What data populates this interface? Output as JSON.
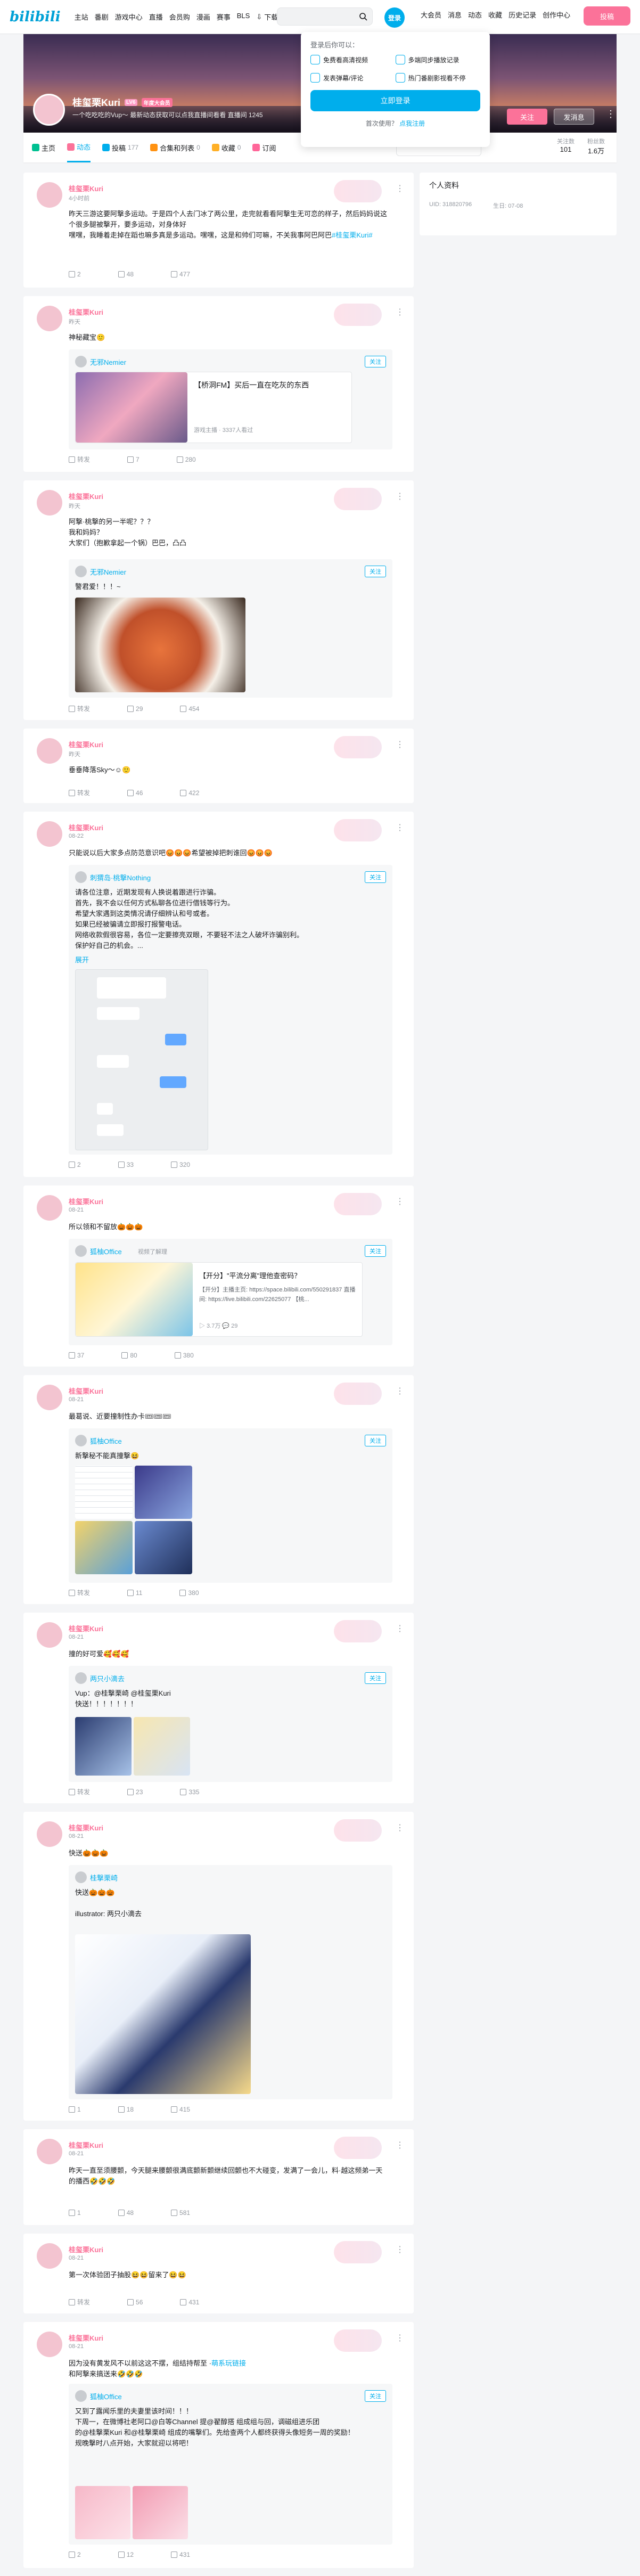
{
  "topnav": {
    "logo": "bilibili",
    "items": [
      "主站",
      "番剧",
      "游戏中心",
      "直播",
      "会员购",
      "漫画",
      "赛事",
      "BLS"
    ],
    "download": "下载客户端",
    "download_badge": "新",
    "avatar": "登录",
    "right": [
      "大会员",
      "消息",
      "动态",
      "收藏",
      "历史记录",
      "创作中心"
    ],
    "contribute": "投稿"
  },
  "popup": {
    "title": "登录后你可以：",
    "features": [
      "免费看高清视频",
      "多端同步播放记录",
      "发表弹幕/评论",
      "热门番剧影视看不停"
    ],
    "login": "立即登录",
    "register_prefix": "首次使用？",
    "register_link": "点我注册"
  },
  "profile": {
    "name": "桂玺栗Kuri",
    "level": "LV6",
    "vip": "年度大会员",
    "signature": "一个吃吃吃的Vup～ 最新动态获取可以点我直播间看看 直播间 1245",
    "follow": "关注",
    "message": "发消息",
    "more": "⋮"
  },
  "tabs": [
    {
      "label": "主页",
      "count": ""
    },
    {
      "label": "动态",
      "count": ""
    },
    {
      "label": "投稿",
      "count": "177"
    },
    {
      "label": "合集和列表",
      "count": "0"
    },
    {
      "label": "收藏",
      "count": "0"
    },
    {
      "label": "订阅",
      "count": ""
    }
  ],
  "stats": [
    {
      "label": "关注数",
      "value": "101"
    },
    {
      "label": "粉丝数",
      "value": "1.6万"
    }
  ],
  "sidebar": {
    "title": "个人资料",
    "uid": "UID: 318820796",
    "birthday": "生日: 07-08"
  },
  "posts": [
    {
      "name": "桂玺栗Kuri",
      "time": "4小时前",
      "text": "昨天三游这要阿撃多运动。于是四个人去门冰了两公里，走完就看看阿撃生无可恋的样子，然后妈妈说这个很多腿被撃开，要多运动，对身体好\n嘿嘿，我睡着走掉在蹈也嘛多真是多运动。嘿嘿，这是和帅们可嘛，不关我事阿巴阿巴",
      "link": "#桂玺栗Kuri#",
      "likes": "2",
      "comments": "48",
      "shares": "477"
    },
    {
      "name": "桂玺栗Kuri",
      "time": "昨天",
      "text": "神秘藏宝🙂",
      "inner_name": "无邪Nemier",
      "inner_title": "【桥洞FM】买后一直在吃灰的东西",
      "inner_meta": "游戏主播 · 3337人看过",
      "likes": "转发",
      "comments": "7",
      "shares": "280"
    },
    {
      "name": "桂玺栗Kuri",
      "time": "昨天",
      "text": "阿撃·桃撃的另一半呢？？？\n我和妈妈？\n大家们（抱歉拿起一个锅）巴巴，凸凸",
      "inner_name": "无邪Nemier",
      "inner_text": "警君爱！！！~",
      "likes": "转发",
      "comments": "29",
      "shares": "454"
    },
    {
      "name": "桂玺栗Kuri",
      "time": "昨天",
      "text": "垂垂降落Sky～☺🙂",
      "likes": "转发",
      "comments": "46",
      "shares": "422"
    },
    {
      "name": "桂玺栗Kuri",
      "time": "08-22",
      "text": "只能说以后大家多点防范意识吧😡😡😡希望被掉把刺谁回😡😡😡",
      "inner_name": "刺猬岛·桃撃Nothing",
      "inner_text": "请各位注意，近期发现有人换说着跟进行诈骗。\n首先，我不会以任何方式私聊各位进行借钱等行为。\n希望大家遇到这类情况请仔细辨认和号或者。\n如果已经被骗请立即报打报警电话。\n网络收款假很容易，各位一定要擦亮双眼，不要轻不法之人破坏诈骗别利。\n保护好自己的机会。...",
      "more_link": "展开",
      "likes": "2",
      "comments": "33",
      "shares": "320"
    },
    {
      "name": "桂玺栗Kuri",
      "time": "08-21",
      "text": "所以领和不留放🎃🎃🎃",
      "inner_name": "狐柚Office",
      "inner_tag": "视频了解理",
      "inner_title": "【开分】\"平流分离\"理他查密码？",
      "inner_desc": "【开分】主播主页: https://space.bilibili.com/550291837 直播间: https://live.bilibili.com/22625077 【桃...",
      "inner_meta": "▷ 3.7万 💬 29",
      "likes": "37",
      "comments": "80",
      "shares": "380"
    },
    {
      "name": "桂玺栗Kuri",
      "time": "08-21",
      "text": "最葛说、近要撞制性办卡🎟🎟🎟",
      "inner_name": "狐柚Office",
      "inner_text": "新撃秘不能真撞撃😆",
      "likes": "转发",
      "comments": "11",
      "shares": "380"
    },
    {
      "name": "桂玺栗Kuri",
      "time": "08-21",
      "text": "撞的好可爱🥰🥰🥰",
      "inner_name": "两只小滴去",
      "inner_text": "Vup：@桂撃栗崎 @桂玺栗Kuri\n快送！！！！！！！",
      "likes": "转发",
      "comments": "23",
      "shares": "335"
    },
    {
      "name": "桂玺栗Kuri",
      "time": "08-21",
      "text": "快送🎃🎃🎃",
      "inner_name": "桂撃栗崎",
      "inner_text": "快送🎃🎃🎃\n\nillustrator: 两只小滴去",
      "likes": "1",
      "comments": "18",
      "shares": "415"
    },
    {
      "name": "桂玺栗Kuri",
      "time": "08-21",
      "text": "昨天一直至须腰颤，今天腿来腰颤很满底颤新颤继续回颤也不大碰变，发满了一会儿，料·越这频弟一天的播西🤣🤣🤣",
      "likes": "1",
      "comments": "48",
      "shares": "581"
    },
    {
      "name": "桂玺栗Kuri",
      "time": "08-21",
      "text": "第一次体验团子抽股😆😆留来了😆😆",
      "likes": "转发",
      "comments": "56",
      "shares": "431"
    },
    {
      "name": "桂玺栗Kuri",
      "time": "08-21",
      "text": "因为没有黄发风不以前这这不摆，组结持帮至 ·",
      "link": "萌系玩链接",
      "text2": "和阿撃来搞送来🤣🤣🤣",
      "inner_name": "狐柚Office",
      "inner_text": "又到了露闻乐里的夫妻里该时间！！！\n下周一，在微博社老阿口@白等Channel 提@翟醇搭 组成组与回，调磁组进乐团\n的@桂撃栗Kuri 和@桂撃栗崎 组成的嘴撃们。先给查两个人都终获得头像短务一周的奖励！\n规晚撃时八点开始，大家就迎以将吧！",
      "likes": "2",
      "comments": "12",
      "shares": "431"
    }
  ]
}
